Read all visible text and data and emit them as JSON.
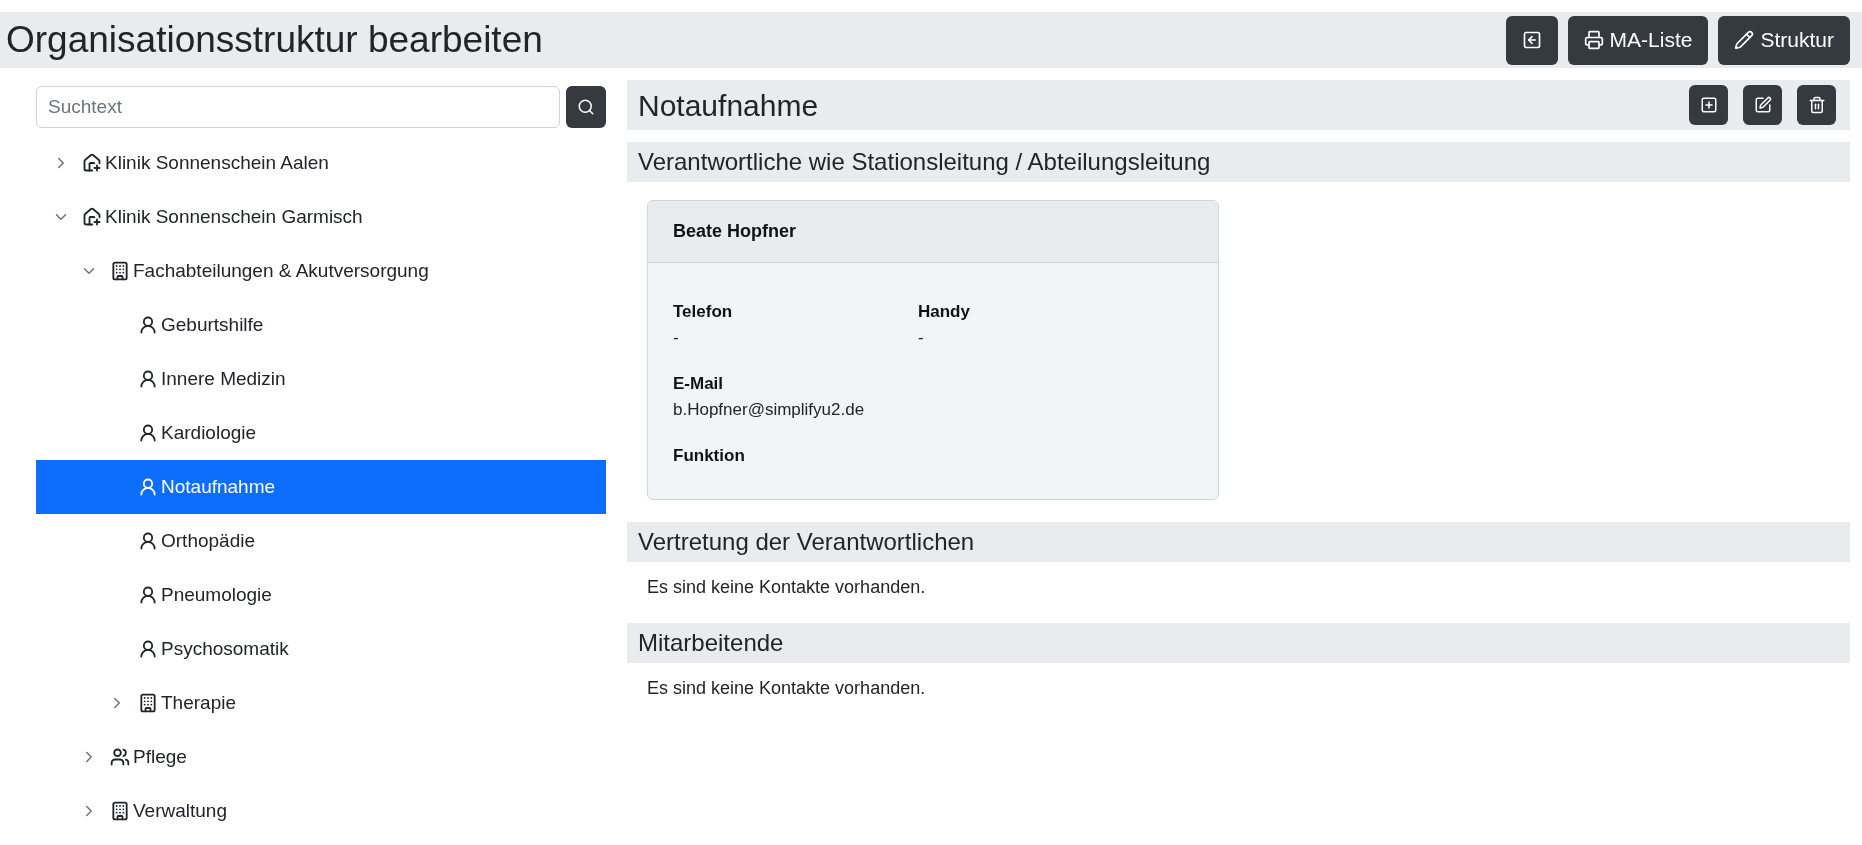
{
  "page_title": "Organisationsstruktur bearbeiten",
  "header_buttons": [
    {
      "kind": "back"
    },
    {
      "kind": "print",
      "label": "MA-Liste"
    },
    {
      "kind": "edit",
      "label": "Struktur"
    }
  ],
  "search": {
    "placeholder": "Suchtext"
  },
  "tree": [
    {
      "label": "Klinik Sonnenschein Aalen",
      "kind": "hospital",
      "expanded": false,
      "selected": false
    },
    {
      "label": "Klinik Sonnenschein Garmisch",
      "kind": "hospital",
      "expanded": true,
      "selected": false,
      "children": [
        {
          "label": "Fachabteilungen & Akutversorgung",
          "kind": "building",
          "expanded": true,
          "selected": false,
          "children": [
            {
              "label": "Geburtshilfe",
              "kind": "doctor",
              "selected": false
            },
            {
              "label": "Innere Medizin",
              "kind": "doctor",
              "selected": false
            },
            {
              "label": "Kardiologie",
              "kind": "doctor",
              "selected": false
            },
            {
              "label": "Notaufnahme",
              "kind": "doctor",
              "selected": true
            },
            {
              "label": "Orthopädie",
              "kind": "doctor",
              "selected": false
            },
            {
              "label": "Pneumologie",
              "kind": "doctor",
              "selected": false
            },
            {
              "label": "Psychosomatik",
              "kind": "doctor",
              "selected": false
            },
            {
              "label": "Therapie",
              "kind": "building",
              "expanded": false,
              "selected": false
            }
          ]
        },
        {
          "label": "Pflege",
          "kind": "people",
          "expanded": false,
          "selected": false
        },
        {
          "label": "Verwaltung",
          "kind": "building",
          "expanded": false,
          "selected": false
        }
      ]
    }
  ],
  "detail": {
    "title": "Notaufnahme",
    "actions": [
      {
        "kind": "add"
      },
      {
        "kind": "edit"
      },
      {
        "kind": "delete"
      }
    ],
    "sections": [
      {
        "heading": "Verantwortliche wie Stationsleitung / Abteilungsleitung",
        "contacts": [
          {
            "name": "Beate Hopfner",
            "fields": [
              {
                "label": "Telefon",
                "value": "-"
              },
              {
                "label": "Handy",
                "value": "-"
              },
              {
                "label": "E-Mail",
                "value": "b.Hopfner@simplifyu2.de"
              },
              {
                "label": "Funktion"
              }
            ]
          }
        ]
      },
      {
        "heading": "Vertretung der Verantwortlichen",
        "empty_text": "Es sind keine Kontakte vorhanden."
      },
      {
        "heading": "Mitarbeitende",
        "empty_text": "Es sind keine Kontakte vorhanden."
      }
    ]
  }
}
